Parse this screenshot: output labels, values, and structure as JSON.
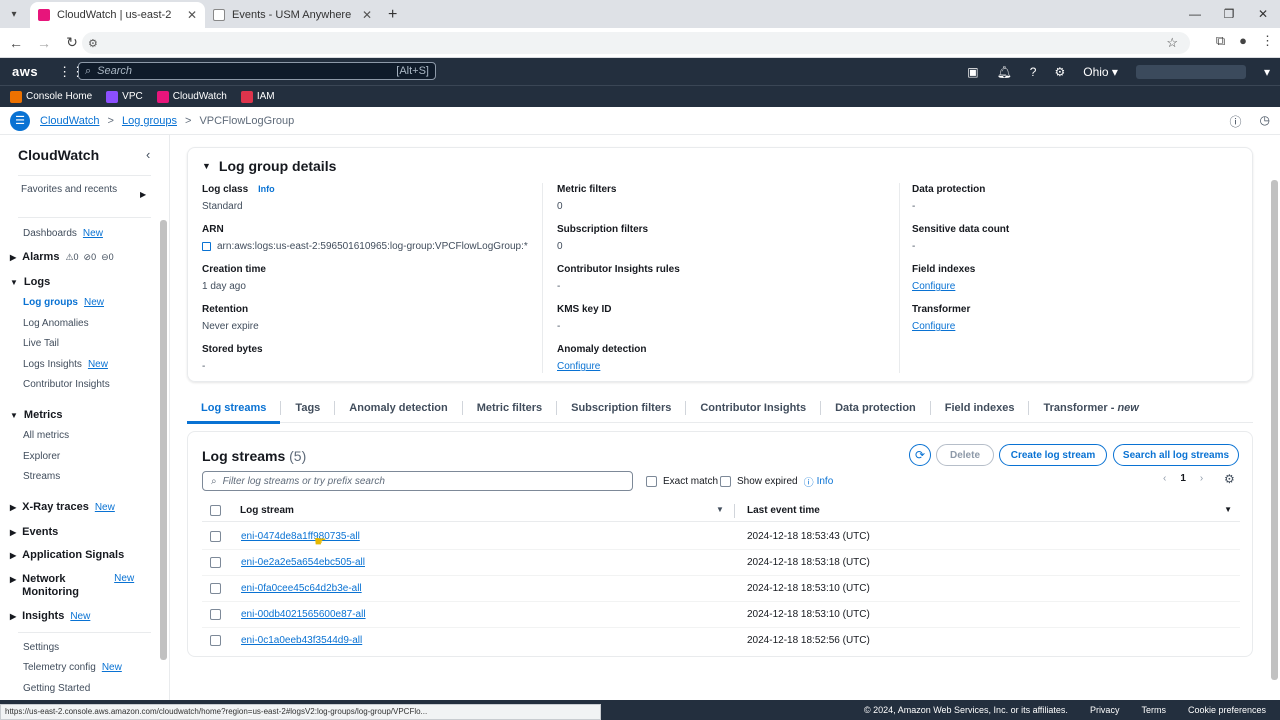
{
  "browser": {
    "tabs": [
      {
        "title": "CloudWatch | us-east-2",
        "favicon_color": "#e7157b"
      },
      {
        "title": "Events - USM Anywhere",
        "favicon_color": "#f4f4f4"
      }
    ]
  },
  "awsnav": {
    "logo": "aws",
    "search_placeholder": "Search",
    "search_shortcut": "[Alt+S]",
    "region": "Ohio ▾"
  },
  "favorites": [
    {
      "label": "Console Home",
      "color": "#ed7100"
    },
    {
      "label": "VPC",
      "color": "#8c4fff"
    },
    {
      "label": "CloudWatch",
      "color": "#e7157b"
    },
    {
      "label": "IAM",
      "color": "#dd344c"
    }
  ],
  "breadcrumb": {
    "items": [
      "CloudWatch",
      "Log groups"
    ],
    "current": "VPCFlowLogGroup"
  },
  "sidebar": {
    "title": "CloudWatch",
    "favorites_label": "Favorites and recents",
    "dashboards": "Dashboards",
    "new": "New",
    "alarms": "Alarms",
    "alarm_counts": [
      "0",
      "0",
      "0"
    ],
    "logs": "Logs",
    "logs_items": [
      "Log groups",
      "Log Anomalies",
      "Live Tail",
      "Logs Insights",
      "Contributor Insights"
    ],
    "metrics": "Metrics",
    "metrics_items": [
      "All metrics",
      "Explorer",
      "Streams"
    ],
    "xray": "X-Ray traces",
    "events": "Events",
    "app_signals": "Application Signals",
    "network": "Network Monitoring",
    "insights": "Insights",
    "bottom_items": [
      "Settings",
      "Telemetry config",
      "Getting Started"
    ]
  },
  "details": {
    "title": "Log group details",
    "info": "Info",
    "log_class": {
      "label": "Log class",
      "value": "Standard"
    },
    "arn": {
      "label": "ARN",
      "value": "arn:aws:logs:us-east-2:596501610965:log-group:VPCFlowLogGroup:*"
    },
    "creation": {
      "label": "Creation time",
      "value": "1 day ago"
    },
    "retention": {
      "label": "Retention",
      "value": "Never expire"
    },
    "stored": {
      "label": "Stored bytes",
      "value": "-"
    },
    "metric_filters": {
      "label": "Metric filters",
      "value": "0"
    },
    "subscription_filters": {
      "label": "Subscription filters",
      "value": "0"
    },
    "contributor_rules": {
      "label": "Contributor Insights rules",
      "value": "-"
    },
    "kms": {
      "label": "KMS key ID",
      "value": "-"
    },
    "anomaly": {
      "label": "Anomaly detection",
      "link": "Configure"
    },
    "data_protection": {
      "label": "Data protection",
      "value": "-"
    },
    "sensitive": {
      "label": "Sensitive data count",
      "value": "-"
    },
    "field_indexes": {
      "label": "Field indexes",
      "link": "Configure"
    },
    "transformer": {
      "label": "Transformer",
      "link": "Configure"
    }
  },
  "tabs": [
    "Log streams",
    "Tags",
    "Anomaly detection",
    "Metric filters",
    "Subscription filters",
    "Contributor Insights",
    "Data protection",
    "Field indexes",
    "Transformer"
  ],
  "tab_transformer_suffix": "new",
  "streams": {
    "title": "Log streams",
    "count": "(5)",
    "delete": "Delete",
    "create": "Create log stream",
    "search_all": "Search all log streams",
    "filter_placeholder": "Filter log streams or try prefix search",
    "exact_match": "Exact match",
    "show_expired": "Show expired",
    "info": "Info",
    "page": "1",
    "col_stream": "Log stream",
    "col_time": "Last event time",
    "rows": [
      {
        "name": "eni-0474de8a1ff980735-all",
        "time": "2024-12-18 18:53:43 (UTC)"
      },
      {
        "name": "eni-0e2a2e5a654ebc505-all",
        "time": "2024-12-18 18:53:18 (UTC)"
      },
      {
        "name": "eni-0fa0cee45c64d2b3e-all",
        "time": "2024-12-18 18:53:10 (UTC)"
      },
      {
        "name": "eni-00db4021565600e87-all",
        "time": "2024-12-18 18:53:10 (UTC)"
      },
      {
        "name": "eni-0c1a0eeb43f3544d9-all",
        "time": "2024-12-18 18:52:56 (UTC)"
      }
    ]
  },
  "footer": {
    "copyright": "© 2024, Amazon Web Services, Inc. or its affiliates.",
    "privacy": "Privacy",
    "terms": "Terms",
    "cookies": "Cookie preferences"
  },
  "status_url": "https://us-east-2.console.aws.amazon.com/cloudwatch/home?region=us-east-2#logsV2:log-groups/log-group/VPCFlo..."
}
